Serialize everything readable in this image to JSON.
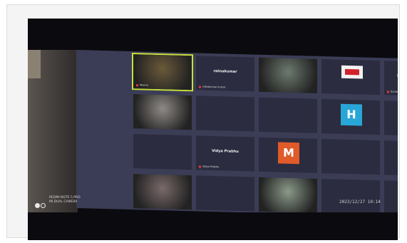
{
  "watermark": {
    "line1": "REDMI NOTE 5 PRO",
    "line2": "MI DUAL CAMERA"
  },
  "timestamp": "2023/12/27 10:14",
  "tiles": [
    {
      "name": "",
      "tag": "Meena",
      "video": true,
      "color": "#6b5a3a"
    },
    {
      "name": "ratnakumar",
      "tag": "ratnakumar kumar",
      "video": false
    },
    {
      "name": "",
      "tag": "",
      "video": true,
      "color": "#6d7a6e"
    },
    {
      "name": "",
      "tag": "",
      "video": false,
      "logo": "CSIR"
    },
    {
      "name": "Sundari Srinivas",
      "tag": "Sundari Srinivas",
      "video": false
    },
    {
      "name": "",
      "tag": "",
      "video": true,
      "color": "#8f8a86"
    },
    {
      "name": "",
      "tag": "",
      "video": false
    },
    {
      "name": "",
      "tag": "",
      "video": false
    },
    {
      "name": "",
      "tag": "",
      "video": false,
      "avatar": "H",
      "avatarColor": "#29a6d8"
    },
    {
      "name": "",
      "tag": "",
      "video": false
    },
    {
      "name": "",
      "tag": "",
      "video": false
    },
    {
      "name": "Vidya Prabhu",
      "tag": "Vidya Prabhu",
      "video": false
    },
    {
      "name": "",
      "tag": "",
      "video": false,
      "avatar": "M",
      "avatarColor": "#e05a2a"
    },
    {
      "name": "",
      "tag": "",
      "video": false
    },
    {
      "name": "",
      "tag": "",
      "video": false
    },
    {
      "name": "",
      "tag": "",
      "video": true,
      "color": "#7a6a6a"
    },
    {
      "name": "",
      "tag": "",
      "video": false
    },
    {
      "name": "",
      "tag": "",
      "video": true,
      "color": "#8a9a8a"
    },
    {
      "name": "",
      "tag": "",
      "video": false
    },
    {
      "name": "",
      "tag": "",
      "video": false
    }
  ]
}
